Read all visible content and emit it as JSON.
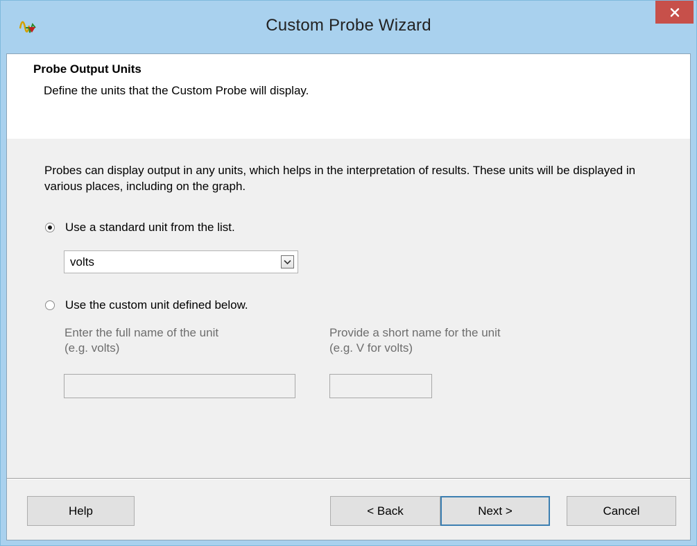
{
  "window": {
    "title": "Custom Probe Wizard",
    "close_glyph": "✕",
    "accent": "#a9d1ee",
    "close_color": "#c7504a"
  },
  "header": {
    "title": "Probe Output Units",
    "subtitle": "Define the units that the Custom Probe will display."
  },
  "body": {
    "description": "Probes can display output in any units, which helps in the interpretation of results. These units will be displayed in various places, including on the graph.",
    "option_standard": {
      "label": "Use a standard unit from the list.",
      "selected": true
    },
    "unit_dropdown": {
      "value": "volts"
    },
    "option_custom": {
      "label": "Use the custom unit defined below.",
      "selected": false
    },
    "full_name": {
      "label_line1": "Enter the full name of the unit",
      "label_line2": "(e.g. volts)",
      "value": ""
    },
    "short_name": {
      "label_line1": "Provide a short name for the unit",
      "label_line2": "(e.g. V for volts)",
      "value": ""
    }
  },
  "footer": {
    "help": "Help",
    "back": "< Back",
    "next": "Next >",
    "cancel": "Cancel"
  }
}
